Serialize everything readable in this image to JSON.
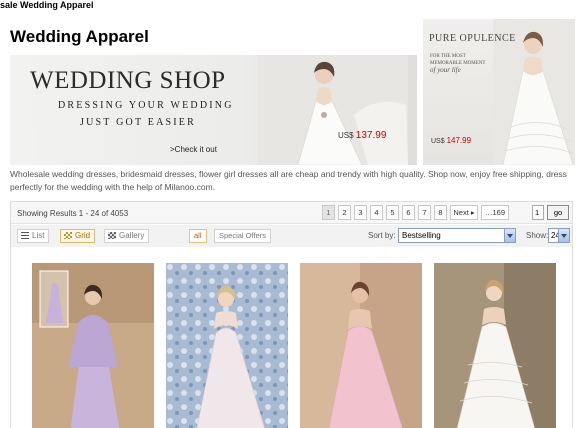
{
  "breadcrumb": "sale Wedding Apparel",
  "page_title": "Wedding Apparel",
  "banner_main": {
    "title": "WEDDING SHOP",
    "tagline_1": "Dressing your wedding",
    "tagline_2": "Just got easier",
    "check_link": ">Check it out",
    "price_prefix": "US$",
    "price": "137.99",
    "dress_color": "#f5f4f2"
  },
  "banner_side": {
    "title": "PURE OPULENCE",
    "subtitle_1": "FOR THE MOST MEMORABLE MOMENT",
    "subtitle_2": "of your life",
    "price_prefix": "US$",
    "price": "147.99"
  },
  "description": "Wholesale wedding dresses, bridesmaid dresses, flower girl dresses all are cheap and trendy with high quality. Shop now, enjoy free shipping, dress perfectly for the wedding with the help of Milanoo.com.",
  "results": {
    "count_text": "Showing Results 1 - 24 of 4053",
    "pages": [
      "1",
      "2",
      "3",
      "4",
      "5",
      "6",
      "7",
      "8"
    ],
    "next_label": "Next ▸",
    "last_label": "…169",
    "page_input": "1",
    "go_label": "go"
  },
  "toolbar": {
    "views": [
      {
        "label": "List",
        "icon": "list-icon"
      },
      {
        "label": "Grid",
        "icon": "grid-icon",
        "active": true
      },
      {
        "label": "Gallery",
        "icon": "gallery-icon"
      }
    ],
    "filters": [
      {
        "label": "all",
        "active": true
      },
      {
        "label": "Special Offers"
      }
    ],
    "sort_label": "Sort by:",
    "sort_value": "Bestselling",
    "show_label": "Show:",
    "show_value": "24"
  },
  "products": [
    {
      "name": "lavender-mother-dress",
      "dress_color": "#c9b4dc",
      "bg_color": "#c7a887"
    },
    {
      "name": "white-mermaid-gown",
      "dress_color": "#f1e6ea",
      "bg_color": "#9aaec9"
    },
    {
      "name": "pink-strapless-gown",
      "dress_color": "#f2c2cf",
      "bg_color": "#c9a68a"
    },
    {
      "name": "white-tiered-gown",
      "dress_color": "#f7f6f2",
      "bg_color": "#a9987e"
    }
  ],
  "colors": {
    "accent_orange": "#b46a00",
    "price_red": "#cc0000",
    "select_border": "#8a9fb8"
  }
}
